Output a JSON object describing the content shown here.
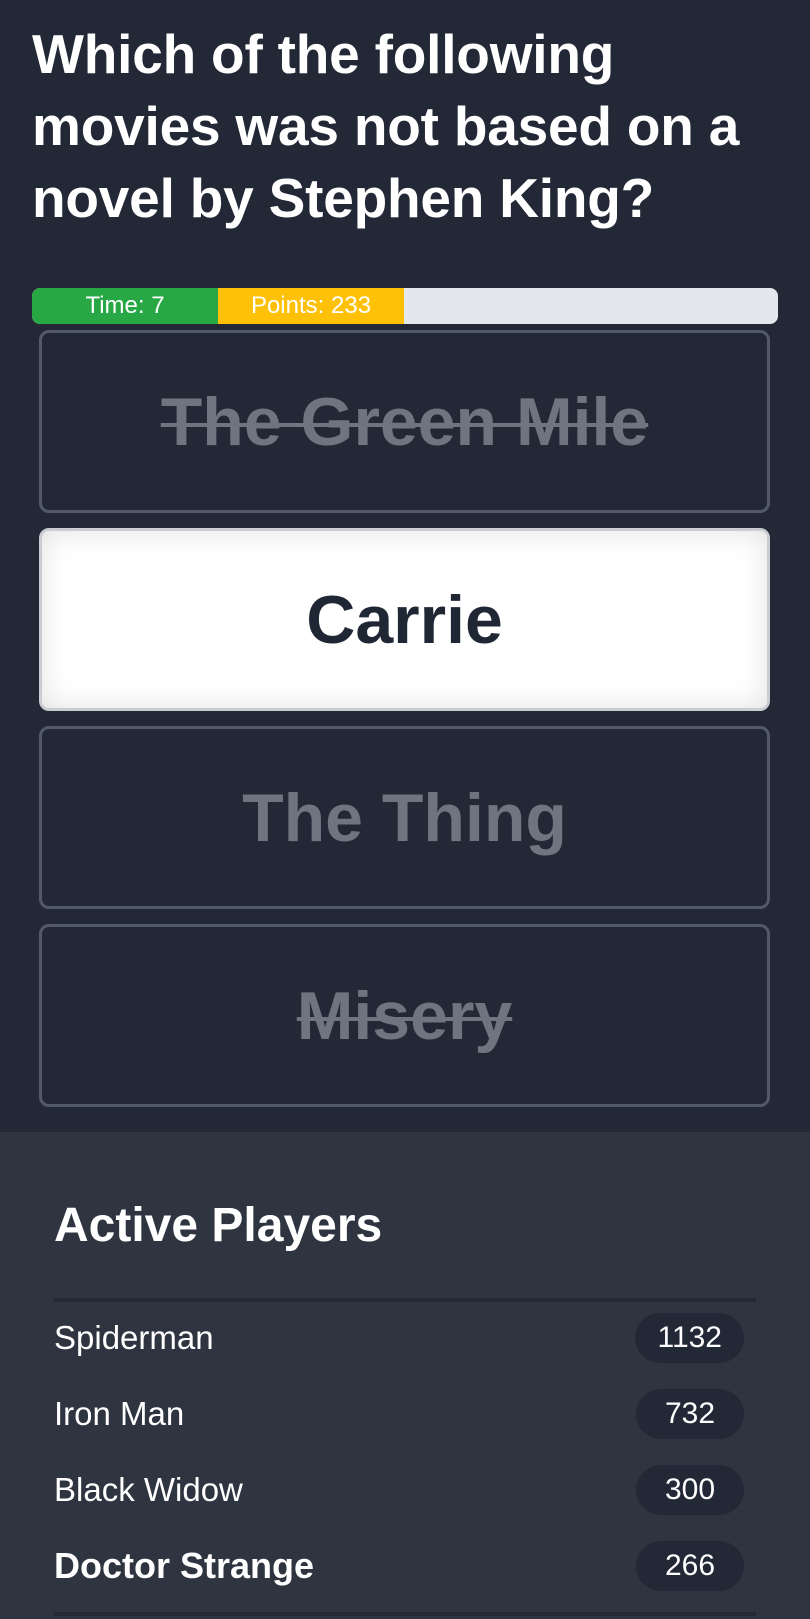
{
  "question": {
    "text": "Which of the following movies was not based on a novel by Stephen King?"
  },
  "progress": {
    "time_label": "Time: 7",
    "points_label": "Points: 233",
    "colors": {
      "time": "#28a745",
      "points": "#ffc107",
      "track": "#e4e7ec"
    }
  },
  "answers": [
    {
      "label": "The Green Mile",
      "state": "eliminated"
    },
    {
      "label": "Carrie",
      "state": "selected"
    },
    {
      "label": "The Thing",
      "state": "default"
    },
    {
      "label": "Misery",
      "state": "eliminated"
    }
  ],
  "players": {
    "title": "Active Players",
    "list": [
      {
        "name": "Spiderman",
        "score": "1132"
      },
      {
        "name": "Iron Man",
        "score": "732"
      },
      {
        "name": "Black Widow",
        "score": "300"
      },
      {
        "name": "Doctor Strange",
        "score": "266"
      }
    ]
  }
}
